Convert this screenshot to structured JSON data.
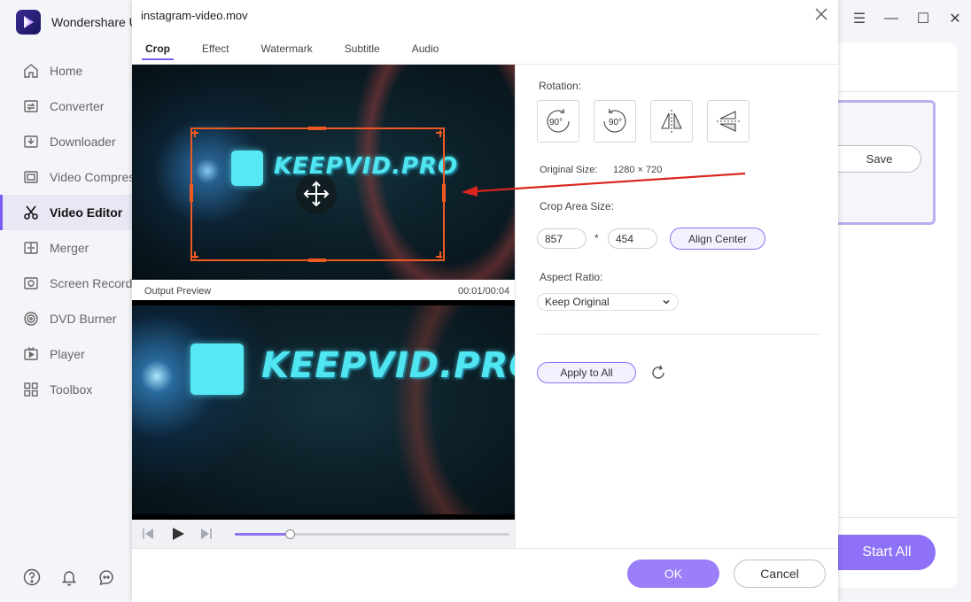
{
  "app": {
    "brand_name": "Wondershare U",
    "nav": [
      {
        "label": "Home",
        "icon": "home-icon"
      },
      {
        "label": "Converter",
        "icon": "converter-icon"
      },
      {
        "label": "Downloader",
        "icon": "downloader-icon"
      },
      {
        "label": "Video Compres",
        "icon": "compress-icon"
      },
      {
        "label": "Video Editor",
        "icon": "scissors-icon",
        "active": true
      },
      {
        "label": "Merger",
        "icon": "merger-icon"
      },
      {
        "label": "Screen Recorde",
        "icon": "screen-recorder-icon"
      },
      {
        "label": "DVD Burner",
        "icon": "dvd-icon"
      },
      {
        "label": "Player",
        "icon": "player-icon"
      },
      {
        "label": "Toolbox",
        "icon": "toolbox-icon"
      }
    ],
    "save_label": "Save",
    "start_all_label": "Start All"
  },
  "dialog": {
    "title": "instagram-video.mov",
    "tabs": [
      "Crop",
      "Effect",
      "Watermark",
      "Subtitle",
      "Audio"
    ],
    "active_tab": "Crop",
    "video_logo_text": "KEEPVID.PRO",
    "output_preview_label": "Output Preview",
    "time": "00:01/00:04",
    "progress_fraction": 0.2,
    "rotation_label": "Rotation:",
    "rotate_left_text": "90°",
    "rotate_right_text": "90°",
    "original_size_label": "Original Size:",
    "original_size_value": "1280 × 720",
    "crop_area_label": "Crop Area Size:",
    "crop_width": "857",
    "crop_times": "*",
    "crop_height": "454",
    "align_center_label": "Align Center",
    "aspect_ratio_label": "Aspect Ratio:",
    "aspect_ratio_value": "Keep Original",
    "apply_all_label": "Apply to All",
    "ok_label": "OK",
    "cancel_label": "Cancel"
  },
  "colors": {
    "accent": "#8e71f7",
    "crop_frame": "#f05a22",
    "annotation_arrow": "#d9251d"
  }
}
